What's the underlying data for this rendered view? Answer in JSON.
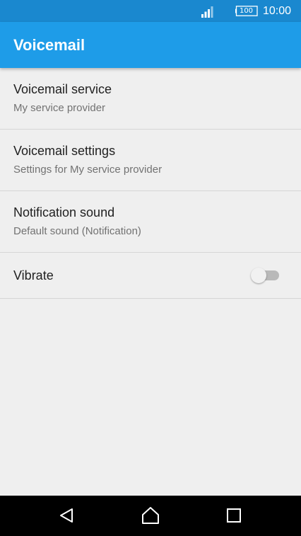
{
  "status_bar": {
    "battery_level": "100",
    "time": "10:00",
    "icons": [
      "signal-icon",
      "battery-icon"
    ]
  },
  "app_bar": {
    "title": "Voicemail"
  },
  "settings": {
    "items": [
      {
        "title": "Voicemail service",
        "subtitle": "My service provider"
      },
      {
        "title": "Voicemail settings",
        "subtitle": "Settings for My service provider"
      },
      {
        "title": "Notification sound",
        "subtitle": "Default sound (Notification)"
      },
      {
        "title": "Vibrate",
        "toggle_on": false
      }
    ]
  },
  "nav_bar": {
    "icons": [
      "back-icon",
      "home-icon",
      "recents-icon"
    ]
  },
  "colors": {
    "status_bar": "#1a88cf",
    "app_bar": "#1e9ce8",
    "background": "#efefef",
    "nav_bar": "#000000"
  }
}
